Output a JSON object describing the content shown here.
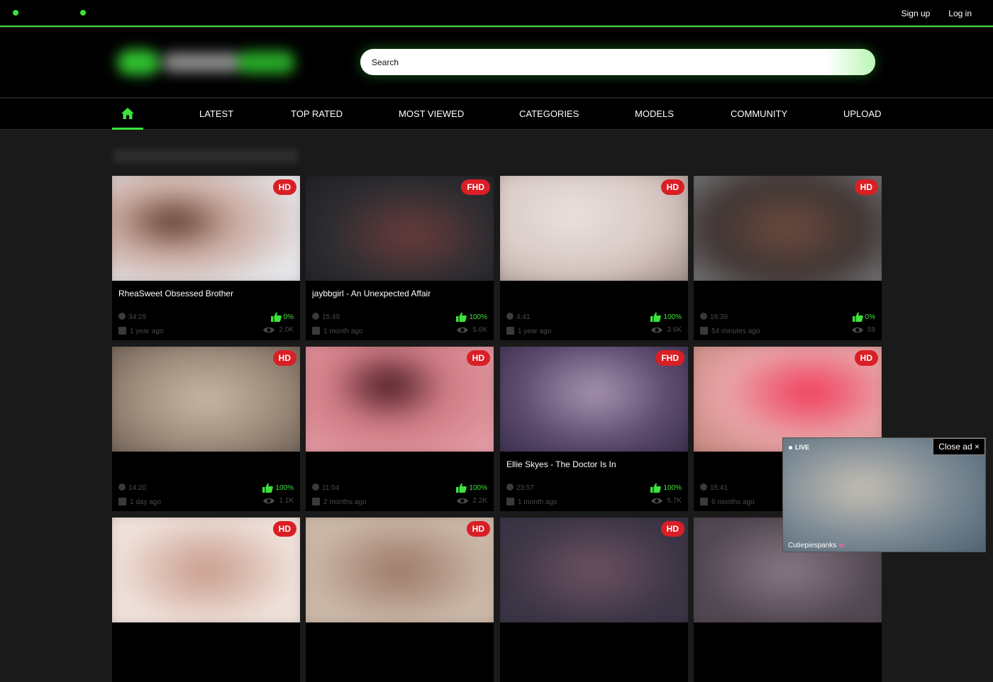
{
  "topbar": {
    "signup_label": "Sign up",
    "login_label": "Log in",
    "accent_color": "#3be33b"
  },
  "search": {
    "placeholder": "Search"
  },
  "nav": {
    "home_icon": "home-icon",
    "items": [
      {
        "label": "LATEST"
      },
      {
        "label": "TOP RATED"
      },
      {
        "label": "MOST VIEWED"
      },
      {
        "label": "CATEGORIES"
      },
      {
        "label": "MODELS"
      },
      {
        "label": "COMMUNITY"
      },
      {
        "label": "UPLOAD"
      }
    ]
  },
  "videos": [
    {
      "badge": "HD",
      "title": "RheaSweet Obsessed Brother",
      "duration": "34:29",
      "rating": "0%",
      "age": "1 year ago",
      "views": "2.0K"
    },
    {
      "badge": "FHD",
      "title": "jaybbgirl - An Unexpected Affair",
      "duration": "15:49",
      "rating": "100%",
      "age": "1 month ago",
      "views": "5.6K"
    },
    {
      "badge": "HD",
      "title": "",
      "duration": "4:41",
      "rating": "100%",
      "age": "1 year ago",
      "views": "3.6K"
    },
    {
      "badge": "HD",
      "title": "",
      "duration": "19:39",
      "rating": "0%",
      "age": "54 minutes ago",
      "views": "59"
    },
    {
      "badge": "HD",
      "title": "",
      "duration": "14:20",
      "rating": "100%",
      "age": "1 day ago",
      "views": "1.1K"
    },
    {
      "badge": "HD",
      "title": "",
      "duration": "11:04",
      "rating": "100%",
      "age": "2 months ago",
      "views": "2.2K"
    },
    {
      "badge": "FHD",
      "title": "Ellie Skyes - The Doctor Is In",
      "duration": "23:57",
      "rating": "100%",
      "age": "1 month ago",
      "views": "5.7K"
    },
    {
      "badge": "HD",
      "title": "",
      "duration": "15:41",
      "rating": "",
      "age": "6 months ago",
      "views": ""
    },
    {
      "badge": "HD"
    },
    {
      "badge": "HD"
    },
    {
      "badge": "HD"
    },
    {
      "badge": ""
    }
  ],
  "live_ad": {
    "live_label": "LIVE",
    "close_label": "Close ad ×",
    "username": "Cutiepiespanks"
  }
}
